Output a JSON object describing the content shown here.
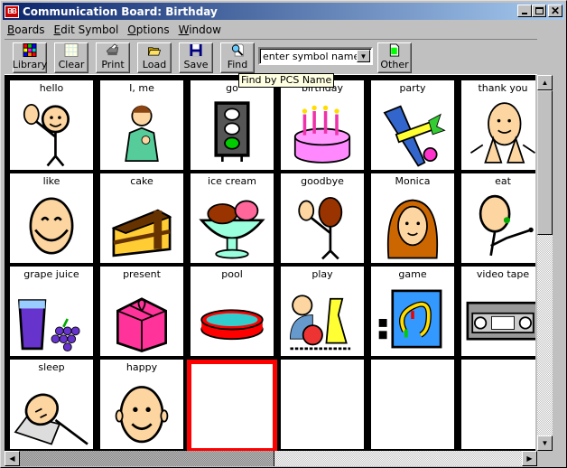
{
  "window": {
    "title": "Communication Board: Birthday",
    "controls": {
      "minimize": "_",
      "maximize": "□",
      "close": "×"
    }
  },
  "menu": [
    {
      "label": "Boards",
      "accel": "B",
      "rest": "oards"
    },
    {
      "label": "Edit Symbol",
      "accel": "E",
      "rest": "dit Symbol"
    },
    {
      "label": "Options",
      "accel": "O",
      "rest": "ptions"
    },
    {
      "label": "Window",
      "accel": "W",
      "rest": "indow"
    }
  ],
  "toolbar": {
    "library": "Library",
    "clear": "Clear",
    "print": "Print",
    "load": "Load",
    "save": "Save",
    "find": "Find",
    "other": "Other",
    "search_value": "enter symbol name",
    "tooltip": "Find by PCS Name"
  },
  "board": {
    "cells": [
      {
        "label": "hello",
        "icon": "waving-person-icon"
      },
      {
        "label": "I, me",
        "icon": "person-pointing-self-icon"
      },
      {
        "label": "go",
        "icon": "traffic-light-green-icon"
      },
      {
        "label": "birthday",
        "icon": "birthday-cake-icon"
      },
      {
        "label": "party",
        "icon": "party-noisemaker-icon"
      },
      {
        "label": "thank you",
        "icon": "thank-you-sign-icon"
      },
      {
        "label": "like",
        "icon": "smiling-face-icon"
      },
      {
        "label": "cake",
        "icon": "cake-slice-icon"
      },
      {
        "label": "ice cream",
        "icon": "ice-cream-sundae-icon"
      },
      {
        "label": "goodbye",
        "icon": "waving-goodbye-icon"
      },
      {
        "label": "Monica",
        "icon": "girl-portrait-icon"
      },
      {
        "label": "eat",
        "icon": "person-eating-icon"
      },
      {
        "label": "grape juice",
        "icon": "grape-juice-icon"
      },
      {
        "label": "present",
        "icon": "gift-box-icon"
      },
      {
        "label": "pool",
        "icon": "wading-pool-icon"
      },
      {
        "label": "play",
        "icon": "child-playing-toys-icon"
      },
      {
        "label": "game",
        "icon": "board-game-icon"
      },
      {
        "label": "video tape",
        "icon": "vhs-tape-icon"
      },
      {
        "label": "sleep",
        "icon": "sleeping-person-icon"
      },
      {
        "label": "happy",
        "icon": "happy-face-icon"
      },
      {
        "label": "",
        "icon": "",
        "selected": true
      },
      {
        "label": "",
        "icon": ""
      },
      {
        "label": "",
        "icon": ""
      },
      {
        "label": "",
        "icon": ""
      }
    ]
  },
  "colors": {
    "selection": "#ff0000",
    "title_gradient_start": "#0a246a",
    "title_gradient_end": "#a6caf0",
    "tooltip_bg": "#ffffe1"
  }
}
